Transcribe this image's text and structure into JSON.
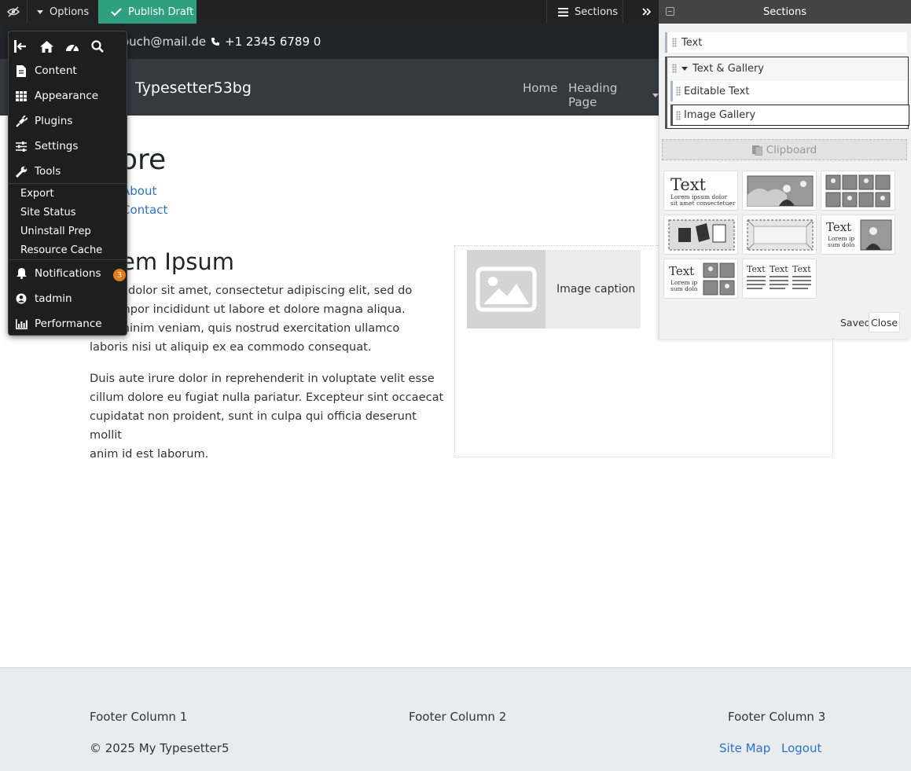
{
  "admin_bar": {
    "options_label": "Options",
    "publish_label": "Publish Draft",
    "sections_label": "Sections",
    "panel_title": "Sections"
  },
  "contact": {
    "email_fragment": "ouch@mail.de",
    "phone": "+1 2345 6789 0"
  },
  "nav": {
    "brand": "Typesetter53bg",
    "items": [
      "Home",
      "Heading Page"
    ]
  },
  "page": {
    "heading_fragment": "ore",
    "links": [
      "About",
      "Contact"
    ],
    "section_heading_fragment": "em Ipsum",
    "para1": "ipsum dolor sit amet, consectetur adipiscing elit, sed do\nod tempor incididunt ut labore et dolore magna aliqua.\nn ad minim veniam, quis nostrud exercitation ullamco\nlaboris nisi ut aliquip ex ea commodo consequat.",
    "para2": "Duis aute irure dolor in reprehenderit in voluptate velit esse\ncillum dolore eu fugiat nulla pariatur. Excepteur sint occaecat\ncupidatat non proident, sunt in culpa qui officia deserunt mollit\nanim id est laborum.",
    "image_caption": "Image caption"
  },
  "footer": {
    "col1": "Footer Column 1",
    "col2": "Footer Column 2",
    "col3": "Footer Column 3",
    "copyright": "© 2025 My Typesetter5",
    "site_map": "Site Map",
    "logout": "Logout"
  },
  "admin_menu": {
    "items": [
      "Content",
      "Appearance",
      "Plugins",
      "Settings",
      "Tools"
    ],
    "tools_sub": [
      "Export",
      "Site Status",
      "Uninstall Prep",
      "Resource Cache"
    ],
    "notifications": "Notifications",
    "notifications_count": "3",
    "user": "tadmin",
    "performance": "Performance"
  },
  "sections_panel": {
    "rows": {
      "text": "Text",
      "group": "Text & Gallery",
      "editable": "Editable Text",
      "gallery": "Image Gallery"
    },
    "clipboard": "Clipboard",
    "tile_text": {
      "big": "Text",
      "lorem1": "Lorem ipsum dolor",
      "lorem2": "sit amet consectetuer",
      "small_text": "Text",
      "lorem_ip": "Lorem ip",
      "sum_dolo": "sum dolo"
    },
    "saved": "Saved",
    "close": "Close"
  },
  "colors": {
    "publish_bg": "#2e9f80",
    "link": "#2c72c7",
    "badge": "#e27b1a"
  }
}
